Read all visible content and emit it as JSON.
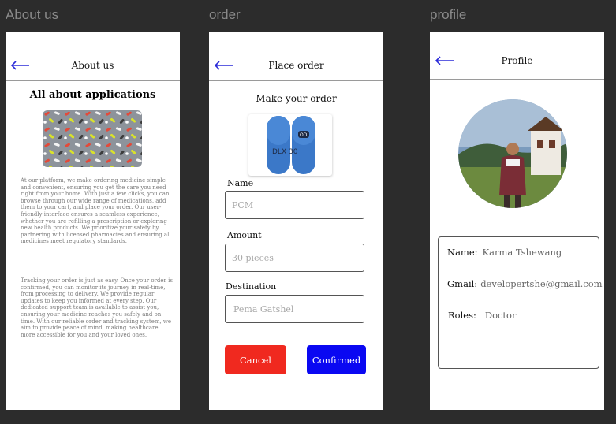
{
  "frames": {
    "about_label": "About us",
    "order_label": "order",
    "profile_label": "profile"
  },
  "about": {
    "title": "About us",
    "heading": "All about applications",
    "image_icon": "pills-pattern-icon",
    "paragraph1": "At our platform, we make ordering medicine simple and convenient, ensuring you get the care you need right from your home. With just a few clicks, you can browse through our wide range of medications, add them to your cart, and place your order. Our user-friendly interface ensures a seamless experience, whether you are refilling a prescription or exploring new health products. We prioritize your safety by partnering with licensed pharmacies and ensuring all medicines meet regulatory standards.",
    "paragraph2": "Tracking your order is just as easy. Once your order is confirmed, you can monitor its journey in real-time, from processing to delivery. We provide regular updates to keep you informed at every step. Our dedicated support team is available to assist you, ensuring your medicine reaches you safely and on time. With our reliable order and tracking system, we aim to provide peace of mind, making healthcare more accessible for you and your loved ones."
  },
  "order": {
    "title": "Place order",
    "subtitle": "Make your order",
    "capsule_text_left": "DLX 30",
    "capsule_text_right": "OD",
    "name_label": "Name",
    "name_placeholder": "PCM",
    "amount_label": "Amount",
    "amount_placeholder": "30 pieces",
    "destination_label": "Destination",
    "destination_placeholder": "Pema Gatshel",
    "cancel_label": "Cancel",
    "confirm_label": "Confirmed"
  },
  "profile": {
    "title": "Profile",
    "photo_icon": "profile-photo-icon",
    "name_key": "Name:",
    "name_value": "Karma Tshewang",
    "gmail_key": "Gmail:",
    "gmail_value": "developertshe@gmail.com",
    "roles_key": "Roles:",
    "roles_value": "Doctor"
  },
  "colors": {
    "back_arrow": "#2b2bd9",
    "cancel": "#f0291f",
    "confirm": "#0a08f2",
    "canvas": "#2c2c2c"
  }
}
